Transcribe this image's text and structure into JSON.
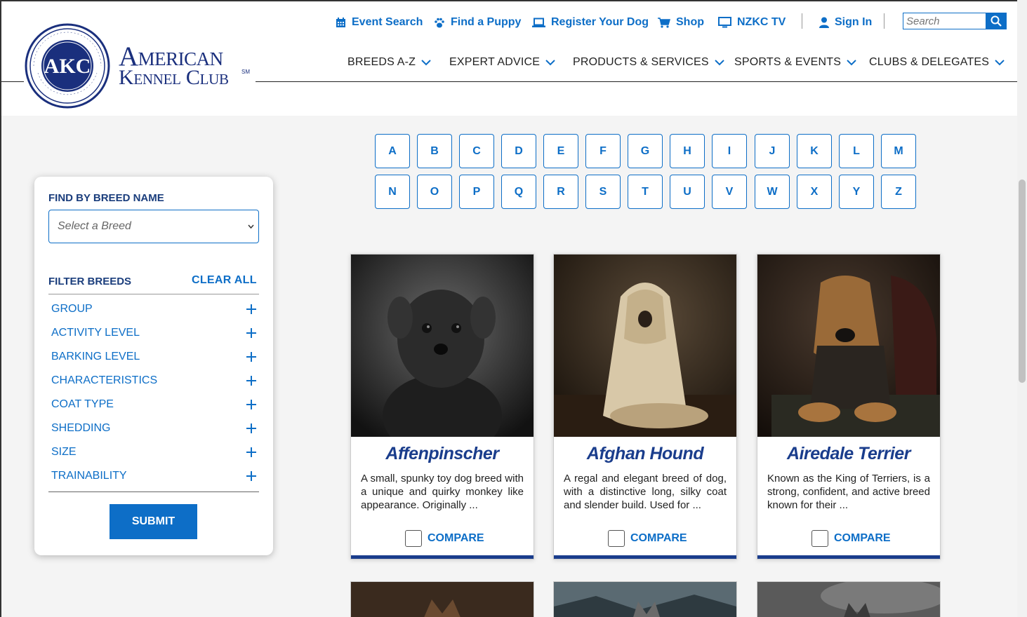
{
  "header": {
    "logo": {
      "line1": "American",
      "line2": "Kennel Club",
      "sm": "SM",
      "seal_text": "AKC"
    },
    "utility_nav": [
      {
        "label": "Event Search",
        "icon": "calendar-icon"
      },
      {
        "label": "Find a Puppy",
        "icon": "paw-icon"
      },
      {
        "label": "Register Your Dog",
        "icon": "laptop-icon"
      },
      {
        "label": "Shop",
        "icon": "cart-icon"
      },
      {
        "label": "NZKC TV",
        "icon": "monitor-icon"
      },
      {
        "label": "Sign In",
        "icon": "user-icon"
      }
    ],
    "search": {
      "placeholder": "Search"
    },
    "main_nav": [
      {
        "label": "BREEDS A-Z"
      },
      {
        "label": "EXPERT ADVICE"
      },
      {
        "label": "PRODUCTS & SERVICES"
      },
      {
        "label": "SPORTS & EVENTS"
      },
      {
        "label": "CLUBS & DELEGATES"
      }
    ]
  },
  "alphabet": [
    "A",
    "B",
    "C",
    "D",
    "E",
    "F",
    "G",
    "H",
    "I",
    "J",
    "K",
    "L",
    "M",
    "N",
    "O",
    "P",
    "Q",
    "R",
    "S",
    "T",
    "U",
    "V",
    "W",
    "X",
    "Y",
    "Z"
  ],
  "filters": {
    "find_by_name_title": "FIND BY BREED NAME",
    "select_placeholder": "Select a Breed",
    "filter_title": "FILTER BREEDS",
    "clear_all": "CLEAR ALL",
    "groups": [
      "GROUP",
      "ACTIVITY LEVEL",
      "BARKING LEVEL",
      "CHARACTERISTICS",
      "COAT TYPE",
      "SHEDDING",
      "SIZE",
      "TRAINABILITY"
    ],
    "submit": "SUBMIT"
  },
  "breeds": [
    {
      "name": "Affenpinscher",
      "description": "A small, spunky toy dog breed with a unique and quirky monkey like appearance. Originally ...",
      "compare": "COMPARE"
    },
    {
      "name": "Afghan Hound",
      "description": "A regal and elegant breed of dog, with a distinctive long, silky coat and slender build. Used for ...",
      "compare": "COMPARE"
    },
    {
      "name": "Airedale Terrier",
      "description": "Known as the King of Terriers, is a strong, confident, and active breed known for their ...",
      "compare": "COMPARE"
    }
  ],
  "colors": {
    "accent": "#0d6ec7",
    "brand_navy": "#1a3d8c",
    "background": "#f4f4f4"
  }
}
